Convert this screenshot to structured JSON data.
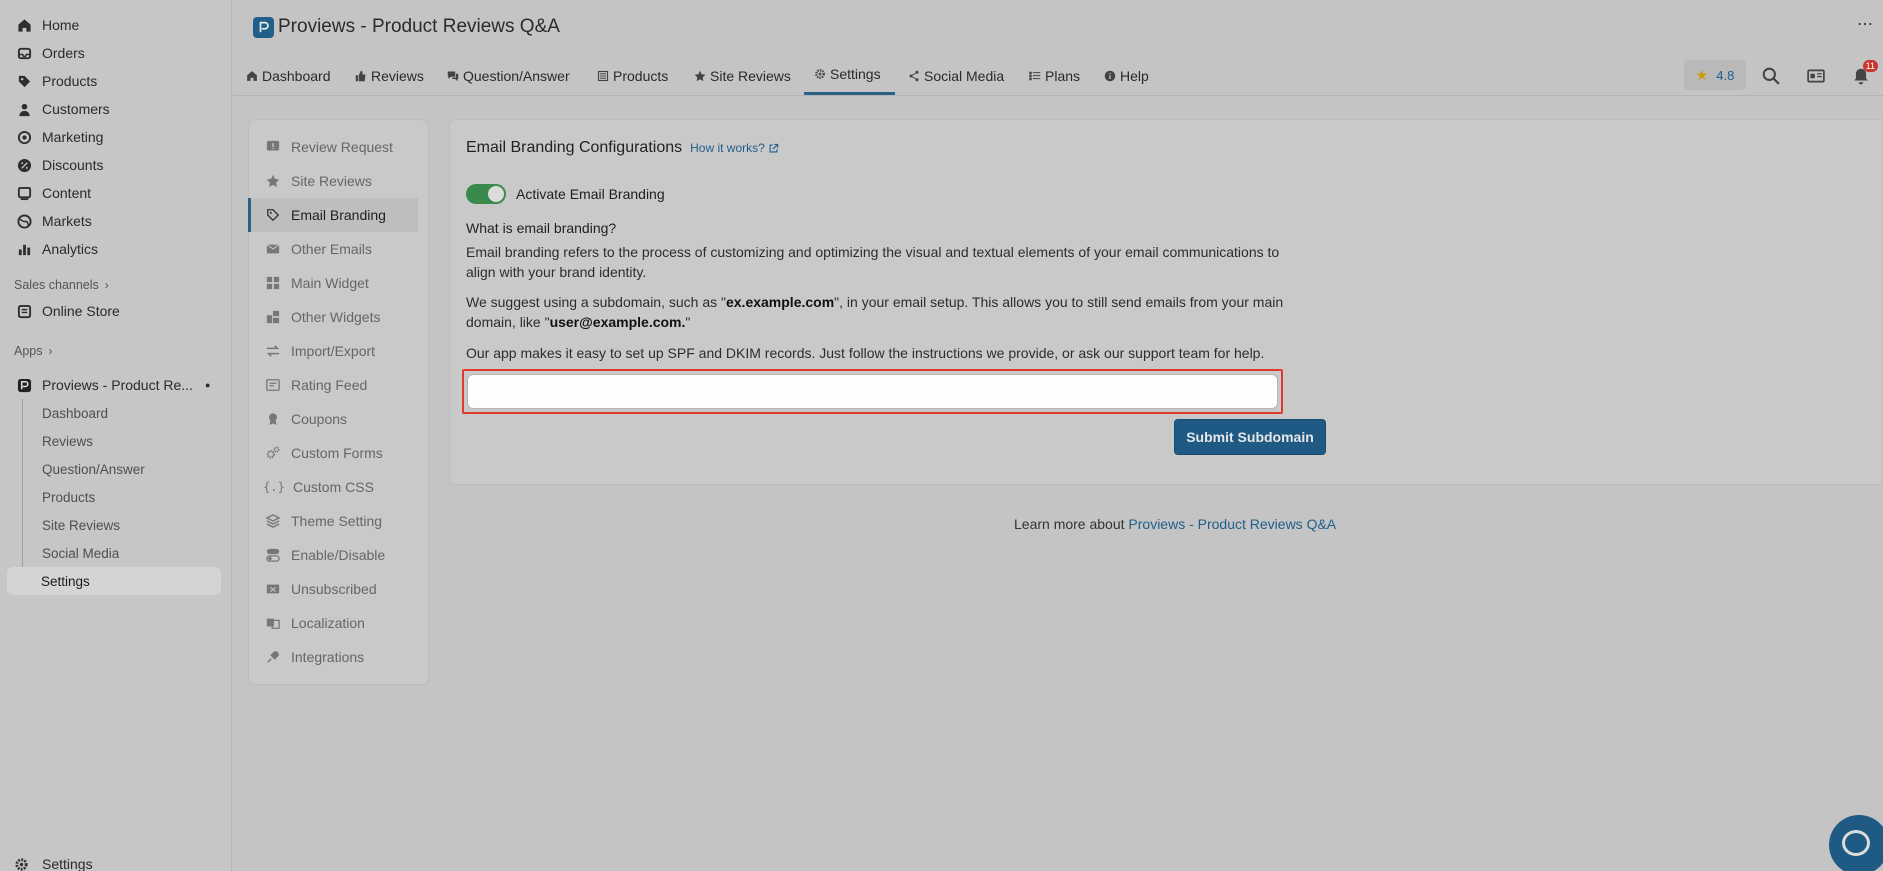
{
  "sidebar": {
    "items": [
      {
        "label": "Home",
        "icon": "home-icon"
      },
      {
        "label": "Orders",
        "icon": "inbox-icon"
      },
      {
        "label": "Products",
        "icon": "tag-icon"
      },
      {
        "label": "Customers",
        "icon": "person-icon"
      },
      {
        "label": "Marketing",
        "icon": "target-icon"
      },
      {
        "label": "Discounts",
        "icon": "discount-icon"
      },
      {
        "label": "Content",
        "icon": "content-icon"
      },
      {
        "label": "Markets",
        "icon": "globe-icon"
      },
      {
        "label": "Analytics",
        "icon": "bar-chart-icon"
      }
    ],
    "sales_channels_label": "Sales channels",
    "online_store": "Online Store",
    "apps_label": "Apps",
    "app_name": "Proviews - Product Re...",
    "app_sub_items": [
      "Dashboard",
      "Reviews",
      "Question/Answer",
      "Products",
      "Site Reviews",
      "Social Media",
      "Settings"
    ],
    "bottom_settings": "Settings"
  },
  "header": {
    "title": "Proviews - Product Reviews Q&A",
    "tabs": [
      "Dashboard",
      "Reviews",
      "Question/Answer",
      "Products",
      "Site Reviews",
      "Settings",
      "Social Media",
      "Plans",
      "Help"
    ],
    "active_tab": "Settings",
    "rating": "4.8",
    "notification_count": "11"
  },
  "settings_menu": {
    "items": [
      "Review Request",
      "Site Reviews",
      "Email Branding",
      "Other Emails",
      "Main Widget",
      "Other Widgets",
      "Import/Export",
      "Rating Feed",
      "Coupons",
      "Custom Forms",
      "Custom CSS",
      "Theme Setting",
      "Enable/Disable",
      "Unsubscribed",
      "Localization",
      "Integrations"
    ],
    "active": "Email Branding"
  },
  "main": {
    "title": "Email Branding Configurations",
    "how_link": "How it works?",
    "toggle_label": "Activate Email Branding",
    "toggle_on": true,
    "question": "What is email branding?",
    "para1": "Email branding refers to the process of customizing and optimizing the visual and textual elements of your email communications to align with your brand identity.",
    "para2_a": "We suggest using a subdomain, such as \"",
    "para2_b": "ex.example.com",
    "para2_c": "\", in your email setup. This allows you to still send emails from your main domain, like \"",
    "para2_d": "user@example.com.",
    "para2_e": "\"",
    "para3": "Our app makes it easy to set up SPF and DKIM records. Just follow the instructions we provide, or ask our support team for help.",
    "subdomain_value": "",
    "submit_label": "Submit Subdomain"
  },
  "footer": {
    "learn_prefix": "Learn more about ",
    "learn_link": "Proviews - Product Reviews Q&A"
  },
  "colors": {
    "accent": "#1f5a85",
    "toggle_on": "#3b8a4d",
    "highlight_border": "#e0392f",
    "star": "#c99b00"
  }
}
